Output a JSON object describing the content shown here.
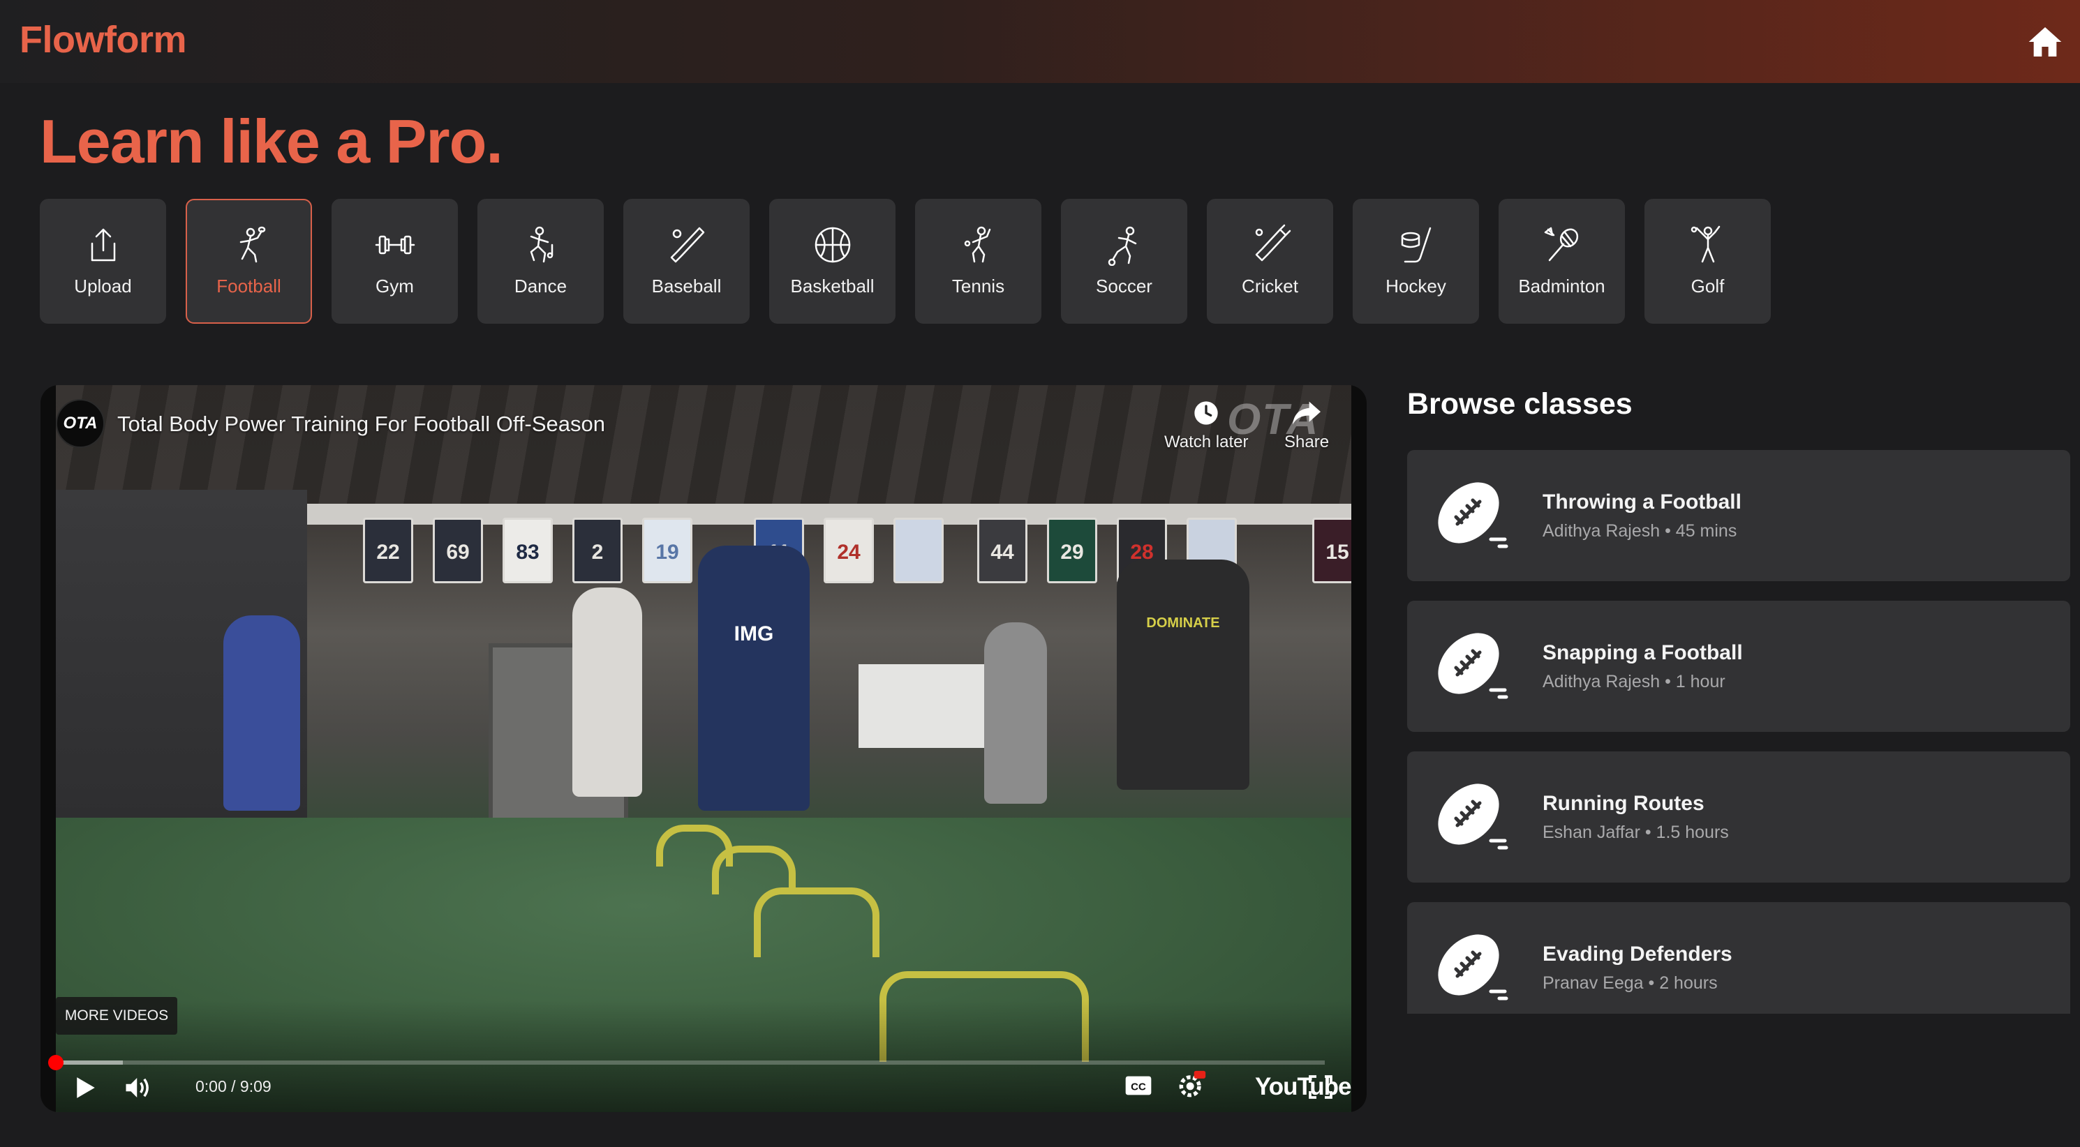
{
  "header": {
    "brand": "Flowform",
    "home_icon": "home-icon"
  },
  "hero": {
    "headline": "Learn like a Pro."
  },
  "categories": [
    {
      "label": "Upload",
      "icon": "upload-icon"
    },
    {
      "label": "Football",
      "icon": "football-player-icon",
      "selected": true
    },
    {
      "label": "Gym",
      "icon": "dumbbell-icon"
    },
    {
      "label": "Dance",
      "icon": "dancer-icon"
    },
    {
      "label": "Baseball",
      "icon": "baseball-bat-icon"
    },
    {
      "label": "Basketball",
      "icon": "basketball-icon"
    },
    {
      "label": "Tennis",
      "icon": "tennis-player-icon"
    },
    {
      "label": "Soccer",
      "icon": "soccer-player-icon"
    },
    {
      "label": "Cricket",
      "icon": "cricket-bat-icon"
    },
    {
      "label": "Hockey",
      "icon": "hockey-icon"
    },
    {
      "label": "Badminton",
      "icon": "badminton-icon"
    },
    {
      "label": "Golf",
      "icon": "golfer-icon"
    }
  ],
  "video": {
    "channel_logo_text": "OTA",
    "title": "Total Body Power Training For Football Off-Season",
    "watch_later_label": "Watch later",
    "share_label": "Share",
    "watermark": "OTA",
    "more_videos_label": "MORE VIDEOS",
    "time": "0:00 / 9:09",
    "progress_played": 0,
    "progress_buffered": 0.053,
    "youtube_label": "YouTube",
    "jerseys": [
      "22",
      "69",
      "83",
      "2",
      "19",
      "11",
      "24",
      "",
      "44",
      "29",
      "28",
      "",
      "15"
    ],
    "shirt_text": "IMG",
    "shirt_text_2": "DOMINATE"
  },
  "browse": {
    "title": "Browse classes",
    "classes": [
      {
        "title": "Throwing a Football",
        "meta": "Adithya Rajesh • 45 mins"
      },
      {
        "title": "Snapping a Football",
        "meta": "Adithya Rajesh • 1 hour"
      },
      {
        "title": "Running Routes",
        "meta": "Eshan Jaffar • 1.5 hours"
      },
      {
        "title": "Evading Defenders",
        "meta": "Pranav Eega • 2 hours"
      }
    ]
  },
  "colors": {
    "accent": "#e8644a",
    "background": "#1c1c1e",
    "card": "#323234",
    "progress_red": "#ff0000"
  }
}
